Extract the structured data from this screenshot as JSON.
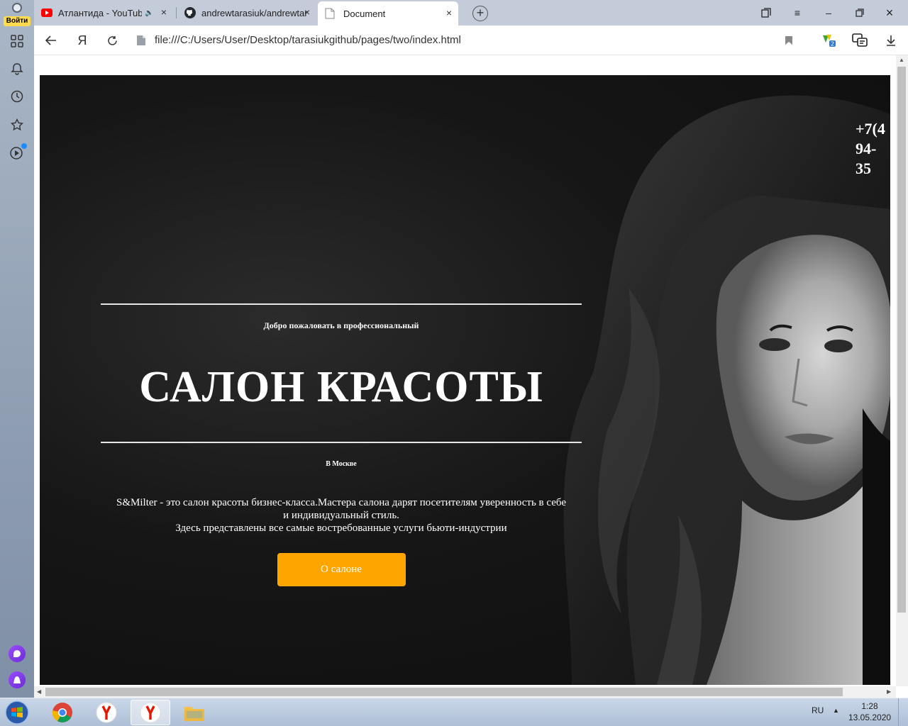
{
  "sidebar": {
    "login_label": "Войти"
  },
  "tabs": [
    {
      "label": "Атлантида - YouTub",
      "icon": "youtube-icon",
      "audio": true
    },
    {
      "label": "andrewtarasiuk/andrewtara",
      "icon": "github-icon"
    },
    {
      "label": "Document",
      "icon": "document-icon",
      "active": true
    }
  ],
  "address_bar": {
    "url": "file:///C:/Users/User/Desktop/tarasiukgithub/pages/two/index.html",
    "yandex_glyph": "Я"
  },
  "page": {
    "phone": "+7(4",
    "phone_line2": "94-",
    "phone_line3": "35",
    "welcome": "Добро пожаловать в профессиональный",
    "title": "САЛОН КРАСОТЫ",
    "city": "В Москве",
    "description_line1": "S&Milter - это салон красоты бизнес-класса.Мастера салона дарят посетителям уверенность в себе",
    "description_line2": "и индивидуальный стиль.",
    "description_line3": "Здесь представлены все самые востребованные услуги бьюти-индустрии",
    "about_button": "О салоне"
  },
  "taskbar": {
    "apps": [
      "chrome-icon",
      "yandex-browser-icon",
      "yandex-browser-active-icon",
      "file-explorer-icon"
    ],
    "language": "RU",
    "time": "1:28",
    "date": "13.05.2020"
  },
  "colors": {
    "accent_button": "#ffa500",
    "page_background": "#141414",
    "login_badge": "#ffdb4d"
  }
}
